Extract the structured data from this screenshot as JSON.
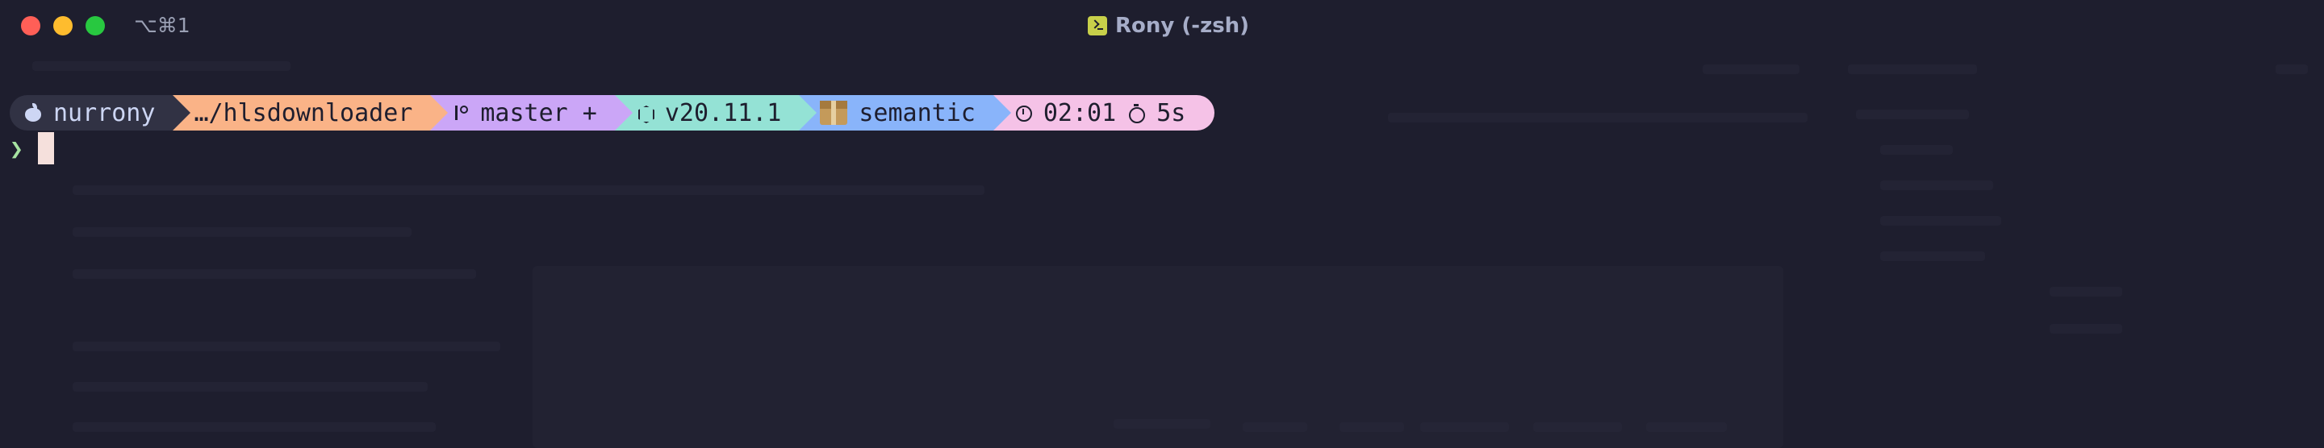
{
  "window": {
    "title": "Rony (-zsh)",
    "shortcut": "⌥⌘1"
  },
  "prompt": {
    "user": "nurrony",
    "path": "…/hlsdownloader",
    "branch": "master +",
    "node_version": "v20.11.1",
    "package": "semantic",
    "time": "02:01",
    "duration": "5s",
    "symbol": "❯"
  },
  "icons": {
    "os": "apple-icon",
    "git": "branch-icon",
    "node": "node-icon",
    "package": "package-box-icon",
    "time": "clock-icon",
    "duration": "stopwatch-icon"
  },
  "colors": {
    "background": "#1e1e2e",
    "os_segment": "#313244",
    "path_segment": "#fab387",
    "git_segment": "#cba6f7",
    "node_segment": "#94e2d5",
    "package_segment": "#89b4fa",
    "time_segment": "#f5c2e7",
    "prompt_symbol": "#a6e3a1",
    "cursor": "#f5e0dc"
  }
}
